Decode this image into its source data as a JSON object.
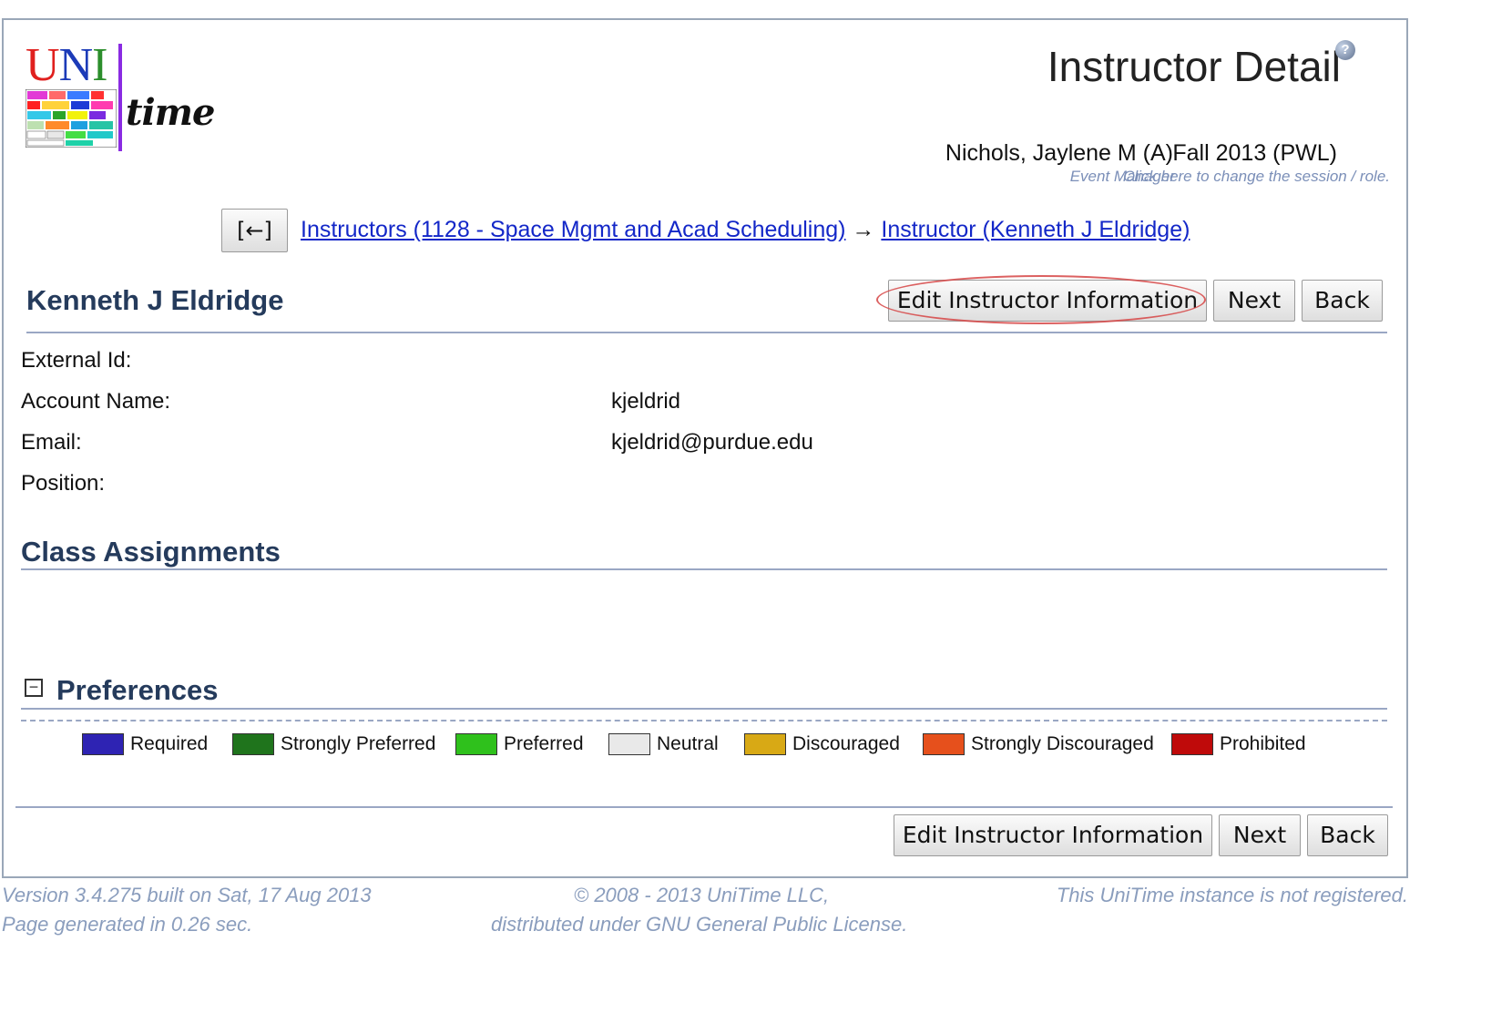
{
  "header": {
    "logo_letters": [
      "U",
      "N",
      "I"
    ],
    "logo_time": "time",
    "page_title": "Instructor Detail",
    "help_icon": "?",
    "user": {
      "name": "Nichols, Jaylene M (A)",
      "role": "Event Manager"
    },
    "session": {
      "name": "Fall 2013 (PWL)",
      "hint": "Click here to change the session / role."
    }
  },
  "nav": {
    "back_label": "[←]",
    "breadcrumb": {
      "first": "Instructors (1128 - Space Mgmt and Acad Scheduling)",
      "separator": "→",
      "second": "Instructor (Kenneth J Eldridge)"
    }
  },
  "instructor": {
    "name": "Kenneth J Eldridge",
    "fields": [
      {
        "label": "External Id:",
        "value": ""
      },
      {
        "label": "Account Name:",
        "value": "kjeldrid"
      },
      {
        "label": "Email:",
        "value": "kjeldrid@purdue.edu"
      },
      {
        "label": "Position:",
        "value": ""
      }
    ]
  },
  "buttons": {
    "edit": "Edit Instructor Information",
    "next": "Next",
    "back": "Back"
  },
  "sections": {
    "class_assignments": "Class Assignments",
    "preferences": "Preferences",
    "collapse_glyph": "−"
  },
  "legend": [
    {
      "label": "Required",
      "color": "#2e23b3"
    },
    {
      "label": "Strongly Preferred",
      "color": "#1f741c"
    },
    {
      "label": "Preferred",
      "color": "#2fc11c"
    },
    {
      "label": "Neutral",
      "color": "#e9e9e9"
    },
    {
      "label": "Discouraged",
      "color": "#d8a915"
    },
    {
      "label": "Strongly Discouraged",
      "color": "#e6501c"
    },
    {
      "label": "Prohibited",
      "color": "#bf0a0a"
    }
  ],
  "footer": {
    "version": "Version 3.4.275 built on Sat, 17 Aug 2013",
    "generated": "Page generated in 0.26 sec.",
    "copyright": "© 2008 - 2013 UniTime LLC,",
    "license": "distributed under GNU General Public License.",
    "registration": "This UniTime instance is not registered."
  }
}
